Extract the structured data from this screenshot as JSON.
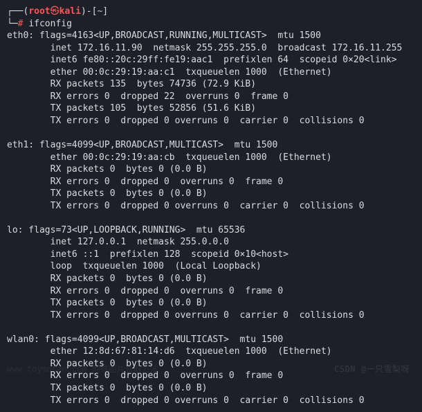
{
  "prompt": {
    "open1": "┌──(",
    "user": "root",
    "at": "㉿",
    "host": "kali",
    "close1": ")-[",
    "path": "~",
    "close2": "]",
    "line2_prefix": "└─",
    "hash": "#",
    "command": "ifconfig"
  },
  "output": "eth0: flags=4163<UP,BROADCAST,RUNNING,MULTICAST>  mtu 1500\n        inet 172.16.11.90  netmask 255.255.255.0  broadcast 172.16.11.255\n        inet6 fe80::20c:29ff:fe19:aac1  prefixlen 64  scopeid 0×20<link>\n        ether 00:0c:29:19:aa:c1  txqueuelen 1000  (Ethernet)\n        RX packets 135  bytes 74736 (72.9 KiB)\n        RX errors 0  dropped 22  overruns 0  frame 0\n        TX packets 105  bytes 52856 (51.6 KiB)\n        TX errors 0  dropped 0 overruns 0  carrier 0  collisions 0\n\neth1: flags=4099<UP,BROADCAST,MULTICAST>  mtu 1500\n        ether 00:0c:29:19:aa:cb  txqueuelen 1000  (Ethernet)\n        RX packets 0  bytes 0 (0.0 B)\n        RX errors 0  dropped 0  overruns 0  frame 0\n        TX packets 0  bytes 0 (0.0 B)\n        TX errors 0  dropped 0 overruns 0  carrier 0  collisions 0\n\nlo: flags=73<UP,LOOPBACK,RUNNING>  mtu 65536\n        inet 127.0.0.1  netmask 255.0.0.0\n        inet6 ::1  prefixlen 128  scopeid 0×10<host>\n        loop  txqueuelen 1000  (Local Loopback)\n        RX packets 0  bytes 0 (0.0 B)\n        RX errors 0  dropped 0  overruns 0  frame 0\n        TX packets 0  bytes 0 (0.0 B)\n        TX errors 0  dropped 0 overruns 0  carrier 0  collisions 0\n\nwlan0: flags=4099<UP,BROADCAST,MULTICAST>  mtu 1500\n        ether 12:8d:67:81:14:d6  txqueuelen 1000  (Ethernet)\n        RX packets 0  bytes 0 (0.0 B)\n        RX errors 0  dropped 0  overruns 0  frame 0\n        TX packets 0  bytes 0 (0.0 B)\n        TX errors 0  dropped 0 overruns 0  carrier 0  collisions 0",
  "watermark_right": "CSDN @一只雪梨呀",
  "watermark_left": "www.toymoban.com 网络图片获取方法"
}
